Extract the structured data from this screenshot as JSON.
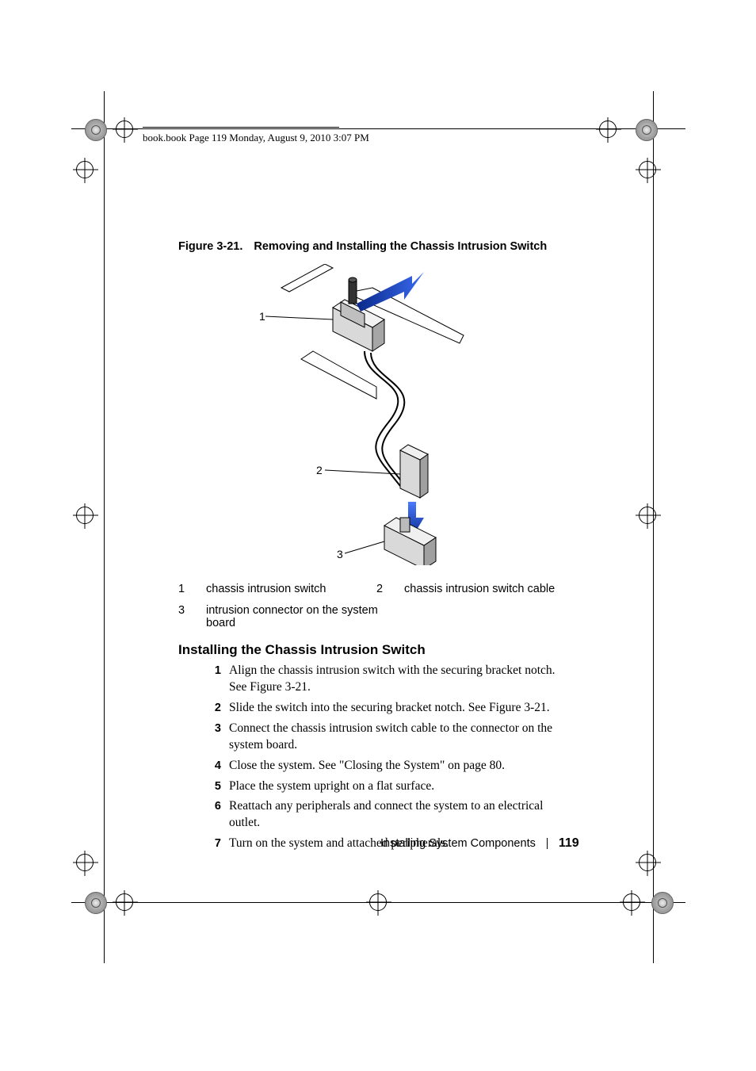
{
  "header": {
    "running_head": "book.book  Page 119  Monday, August 9, 2010  3:07 PM"
  },
  "figure": {
    "caption_label": "Figure 3-21.",
    "caption_title": "Removing and Installing the Chassis Intrusion Switch",
    "callouts": {
      "c1": "1",
      "c2": "2",
      "c3": "3"
    }
  },
  "legend": {
    "items": [
      {
        "num": "1",
        "text": "chassis intrusion switch"
      },
      {
        "num": "2",
        "text": "chassis intrusion switch cable"
      },
      {
        "num": "3",
        "text": "intrusion connector on the system board"
      }
    ]
  },
  "section": {
    "heading": "Installing the Chassis Intrusion Switch",
    "steps": [
      {
        "num": "1",
        "text": "Align the chassis intrusion switch with the securing bracket notch. See Figure 3-21."
      },
      {
        "num": "2",
        "text": "Slide the switch into the securing bracket notch. See Figure 3-21."
      },
      {
        "num": "3",
        "text": "Connect the chassis intrusion switch cable to the connector on the system board."
      },
      {
        "num": "4",
        "text": "Close the system. See \"Closing the System\" on page 80."
      },
      {
        "num": "5",
        "text": "Place the system upright on a flat surface."
      },
      {
        "num": "6",
        "text": "Reattach any peripherals and connect the system to an electrical outlet."
      },
      {
        "num": "7",
        "text": "Turn on the system and attached peripherals."
      }
    ]
  },
  "footer": {
    "chapter": "Installing System Components",
    "page": "119"
  }
}
